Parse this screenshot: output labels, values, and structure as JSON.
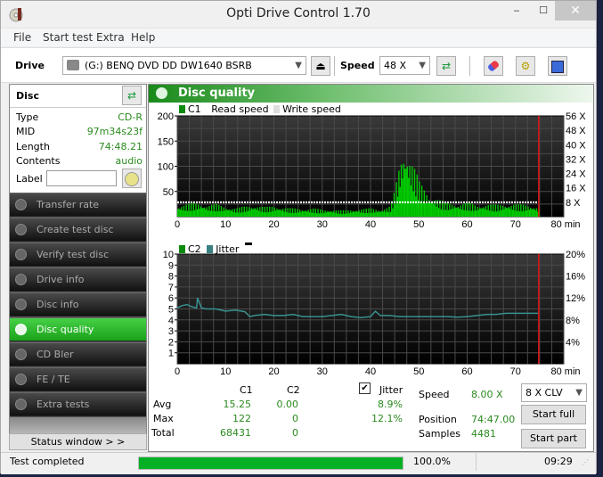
{
  "window": {
    "title": "Opti Drive Control 1.70",
    "min_glyph": "‒",
    "max_glyph": "☐",
    "close_glyph": "✕"
  },
  "menu": [
    "File",
    "Start test",
    "Extra",
    "Help"
  ],
  "toolbar": {
    "drive_label": "Drive",
    "drive_value": "(G:)   BENQ DVD DD DW1640 BSRB",
    "speed_label": "Speed",
    "speed_value": "48 X",
    "icons": [
      "eject-icon",
      "refresh-icon",
      "eraser-icon",
      "settings-icon",
      "save-icon"
    ]
  },
  "disc": {
    "title": "Disc",
    "rows": [
      {
        "key": "Type",
        "value": "CD-R"
      },
      {
        "key": "MID",
        "value": "97m34s23f"
      },
      {
        "key": "Length",
        "value": "74:48.21"
      },
      {
        "key": "Contents",
        "value": "audio"
      }
    ],
    "label_key": "Label",
    "label_value": ""
  },
  "nav": [
    {
      "label": "Transfer rate",
      "active": false
    },
    {
      "label": "Create test disc",
      "active": false
    },
    {
      "label": "Verify test disc",
      "active": false
    },
    {
      "label": "Drive info",
      "active": false
    },
    {
      "label": "Disc info",
      "active": false
    },
    {
      "label": "Disc quality",
      "active": true
    },
    {
      "label": "CD Bler",
      "active": false
    },
    {
      "label": "FE / TE",
      "active": false
    },
    {
      "label": "Extra tests",
      "active": false
    }
  ],
  "status_window_label": "Status window > >",
  "main": {
    "title": "Disc quality",
    "legend1": {
      "c1": "C1",
      "read": "Read speed",
      "write": "Write speed"
    },
    "legend2": {
      "c2": "C2",
      "jitter": "Jitter"
    }
  },
  "stats": {
    "col_c1": "C1",
    "col_c2": "C2",
    "jitter_label": "Jitter",
    "jitter_checked": true,
    "rows": [
      {
        "label": "Avg",
        "c1": "15.25",
        "c2": "0.00",
        "jitter": "8.9%"
      },
      {
        "label": "Max",
        "c1": "122",
        "c2": "0",
        "jitter": "12.1%"
      },
      {
        "label": "Total",
        "c1": "68431",
        "c2": "0",
        "jitter": ""
      }
    ],
    "speed_label": "Speed",
    "speed_value": "8.00 X",
    "position_label": "Position",
    "position_value": "74:47.00",
    "samples_label": "Samples",
    "samples_value": "4481",
    "speed_select": "8 X CLV",
    "start_full": "Start full",
    "start_part": "Start part"
  },
  "statusbar": {
    "text": "Test completed",
    "progress": 100.0,
    "progress_text": "100.0%",
    "time": "09:29"
  },
  "chart_data": [
    {
      "type": "bar",
      "title": "C1 / Read speed",
      "xlabel": "min",
      "x_ticks": [
        0,
        10,
        20,
        30,
        40,
        50,
        60,
        70,
        80
      ],
      "xlim": [
        0,
        80
      ],
      "y_ticks_left": [
        50,
        100,
        150,
        200
      ],
      "ylim_left": [
        0,
        200
      ],
      "y_ticks_right": [
        "8 X",
        "16 X",
        "24 X",
        "32 X",
        "40 X",
        "48 X",
        "56 X"
      ],
      "ylim_right": [
        0,
        56
      ],
      "end_marker_min": 74.8,
      "read_speed_x": 8,
      "series": [
        {
          "name": "C1",
          "x": [
            0,
            2,
            4,
            6,
            8,
            10,
            12,
            14,
            16,
            18,
            20,
            22,
            24,
            26,
            28,
            30,
            32,
            34,
            36,
            38,
            40,
            42,
            44,
            45,
            46,
            47,
            48,
            49,
            50,
            51,
            52,
            53,
            54,
            55,
            56,
            58,
            60,
            62,
            64,
            66,
            68,
            70,
            72,
            74,
            74.8
          ],
          "values": [
            15,
            18,
            20,
            16,
            18,
            14,
            12,
            15,
            16,
            14,
            15,
            13,
            12,
            11,
            12,
            10,
            10,
            9,
            10,
            11,
            12,
            10,
            15,
            40,
            80,
            100,
            85,
            70,
            50,
            40,
            30,
            28,
            25,
            22,
            20,
            18,
            20,
            16,
            18,
            17,
            18,
            18,
            17,
            15,
            12
          ]
        }
      ],
      "legend": [
        "C1",
        "Read speed",
        "Write speed"
      ],
      "grid": true
    },
    {
      "type": "line",
      "title": "C2 / Jitter",
      "xlabel": "min",
      "x_ticks": [
        0,
        10,
        20,
        30,
        40,
        50,
        60,
        70,
        80
      ],
      "xlim": [
        0,
        80
      ],
      "y_ticks_left": [
        1,
        2,
        3,
        4,
        5,
        6,
        7,
        8,
        9,
        10
      ],
      "ylim_left": [
        0,
        10
      ],
      "y_ticks_right": [
        "4%",
        "8%",
        "12%",
        "16%",
        "20%"
      ],
      "ylim_right": [
        0,
        20
      ],
      "end_marker_min": 74.8,
      "series": [
        {
          "name": "C2",
          "x": [
            0,
            74.8
          ],
          "values": [
            0,
            0
          ]
        },
        {
          "name": "Jitter",
          "x": [
            0,
            1,
            2,
            3,
            4,
            4.2,
            5,
            6,
            8,
            10,
            12,
            14,
            15,
            16,
            18,
            20,
            22,
            24,
            26,
            28,
            30,
            32,
            34,
            36,
            38,
            40,
            41,
            42,
            44,
            46,
            48,
            50,
            52,
            54,
            56,
            58,
            60,
            62,
            64,
            66,
            68,
            70,
            72,
            74,
            74.8
          ],
          "values": [
            10.2,
            10.6,
            10.8,
            10.4,
            10.2,
            12.0,
            10.2,
            10.0,
            10.0,
            9.6,
            9.8,
            9.5,
            8.6,
            8.8,
            9.0,
            8.8,
            8.8,
            9.0,
            8.6,
            8.6,
            8.6,
            8.8,
            9.0,
            8.6,
            8.4,
            8.6,
            9.6,
            8.8,
            8.8,
            8.6,
            8.6,
            8.6,
            8.6,
            8.6,
            8.6,
            8.5,
            8.6,
            8.8,
            9.0,
            9.0,
            9.2,
            9.2,
            9.2,
            9.2,
            9.2
          ]
        }
      ],
      "legend": [
        "C2",
        "Jitter"
      ],
      "grid": true
    }
  ]
}
